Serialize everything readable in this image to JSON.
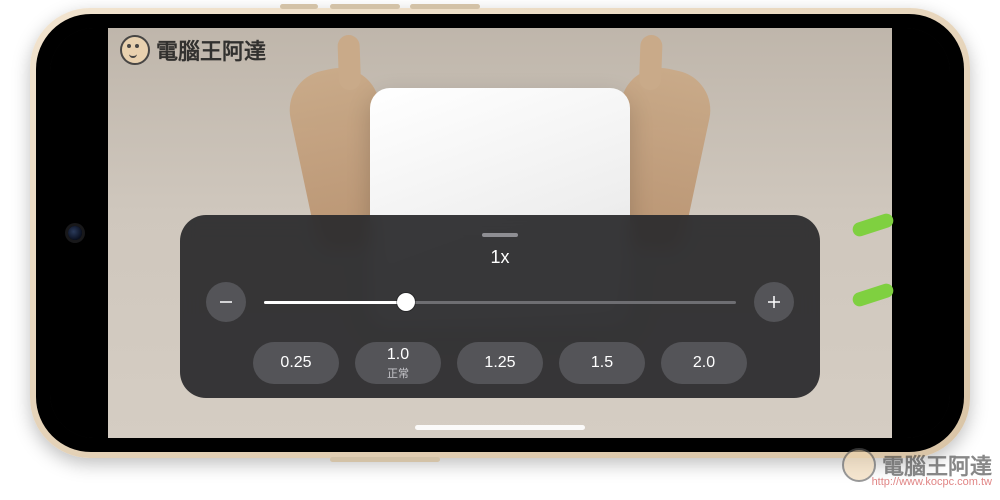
{
  "watermark": {
    "text_tl": "電腦王阿達",
    "text_br": "電腦王阿達",
    "url": "http://www.kocpc.com.tw"
  },
  "speed_sheet": {
    "current_label": "1x",
    "slider": {
      "min": 0.25,
      "max": 2.0,
      "value": 1.0,
      "fill_pct": 30
    },
    "decrease_name": "minus-icon",
    "increase_name": "plus-icon",
    "presets": [
      {
        "label": "0.25",
        "sub": ""
      },
      {
        "label": "1.0",
        "sub": "正常"
      },
      {
        "label": "1.25",
        "sub": ""
      },
      {
        "label": "1.5",
        "sub": ""
      },
      {
        "label": "2.0",
        "sub": ""
      }
    ]
  }
}
